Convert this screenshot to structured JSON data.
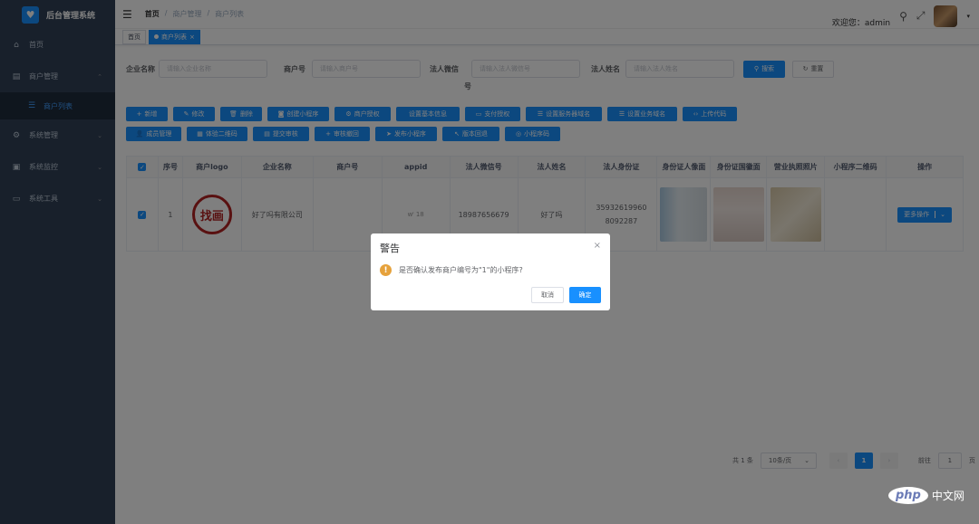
{
  "app": {
    "title": "后台管理系统"
  },
  "sidebar": {
    "items": [
      {
        "label": "首页",
        "icon": "home-icon"
      },
      {
        "label": "商户管理",
        "icon": "shop-icon"
      },
      {
        "label": "商户列表",
        "icon": "list-icon"
      },
      {
        "label": "系统管理",
        "icon": "gear-icon"
      },
      {
        "label": "系统监控",
        "icon": "monitor-icon"
      },
      {
        "label": "系统工具",
        "icon": "tool-icon"
      }
    ]
  },
  "navbar": {
    "breadcrumb": [
      "首页",
      "/",
      "商户管理",
      "/",
      "商户列表"
    ],
    "welcome": "欢迎您：admin"
  },
  "tags": {
    "home": "首页",
    "active": "商户列表"
  },
  "search": {
    "company_label": "企业名称",
    "company_placeholder": "请输入企业名称",
    "merchant_no_label": "商户号",
    "merchant_no_placeholder": "请输入商户号",
    "wechat_label": "法人微信",
    "wechat_label_2": "号",
    "wechat_placeholder": "请输入法人微信号",
    "name_label": "法人姓名",
    "name_placeholder": "请输入法人姓名",
    "search_btn": "搜索",
    "reset_btn": "重置"
  },
  "toolbar": {
    "row1": [
      "新增",
      "修改",
      "删除",
      "创建小程序",
      "商户授权",
      "设置基本信息",
      "支付授权",
      "设置服务器域名",
      "设置业务域名",
      "上传代码"
    ],
    "row2": [
      "成员管理",
      "体验二维码",
      "提交审核",
      "审核撤回",
      "发布小程序",
      "版本回退",
      "小程序码"
    ]
  },
  "table": {
    "headers": [
      "序号",
      "商户logo",
      "企业名称",
      "商户号",
      "appid",
      "法人微信号",
      "法人姓名",
      "法人身份证",
      "身份证人像面",
      "身份证国徽面",
      "营业执照照片",
      "小程序二维码",
      "操作"
    ],
    "row": {
      "index": "1",
      "logo_text": "找",
      "logo_text_2": "画",
      "company": "好了吗有限公司",
      "merchant_no": "",
      "appid": "wᴵ          18",
      "wechat": "18987656679",
      "name": "好了吗",
      "id_card": "35932619960 8092287",
      "more_btn": "更多操作"
    }
  },
  "pagination": {
    "total": "共 1 条",
    "page_size": "10条/页",
    "current": "1",
    "goto": "前往",
    "goto_value": "1",
    "page_unit": "页"
  },
  "dialog": {
    "title": "警告",
    "message": "是否确认发布商户编号为\"1\"的小程序?",
    "cancel": "取消",
    "confirm": "确定"
  },
  "watermark": {
    "brand": "php",
    "site": "中文网"
  }
}
